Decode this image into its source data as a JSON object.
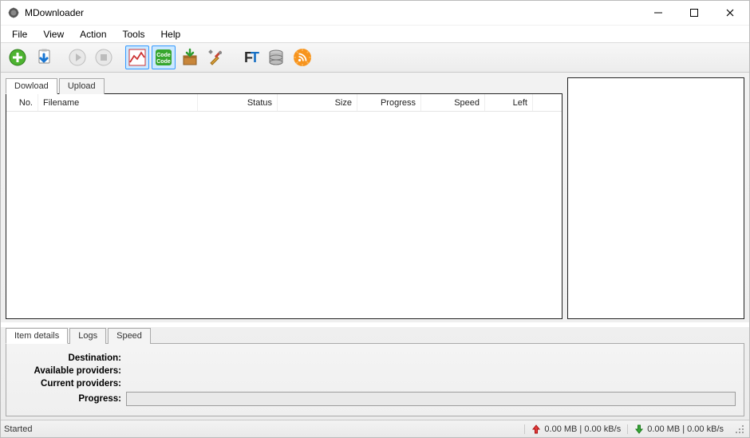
{
  "app": {
    "title": "MDownloader"
  },
  "menu": {
    "file": "File",
    "view": "View",
    "action": "Action",
    "tools": "Tools",
    "help": "Help"
  },
  "tabs_main": {
    "download": "Dowload",
    "upload": "Upload"
  },
  "columns": {
    "no": "No.",
    "filename": "Filename",
    "status": "Status",
    "size": "Size",
    "progress": "Progress",
    "speed": "Speed",
    "left": "Left"
  },
  "tabs_detail": {
    "item_details": "Item details",
    "logs": "Logs",
    "speed": "Speed"
  },
  "details": {
    "destination_label": "Destination:",
    "available_label": "Available providers:",
    "current_label": "Current providers:",
    "progress_label": "Progress:",
    "destination_value": "",
    "available_value": "",
    "current_value": ""
  },
  "status": {
    "left_text": "Started",
    "up_text": "0.00 MB | 0.00 kB/s",
    "down_text": "0.00 MB | 0.00 kB/s"
  },
  "icons": {
    "add": "add-icon",
    "clipboard": "clipboard-download-icon",
    "play": "play-icon",
    "stop": "stop-icon",
    "chart": "chart-icon",
    "code": "code-icon",
    "package": "package-icon",
    "tools": "tools-icon",
    "ft": "ft-icon",
    "db": "database-icon",
    "rss": "rss-icon"
  }
}
